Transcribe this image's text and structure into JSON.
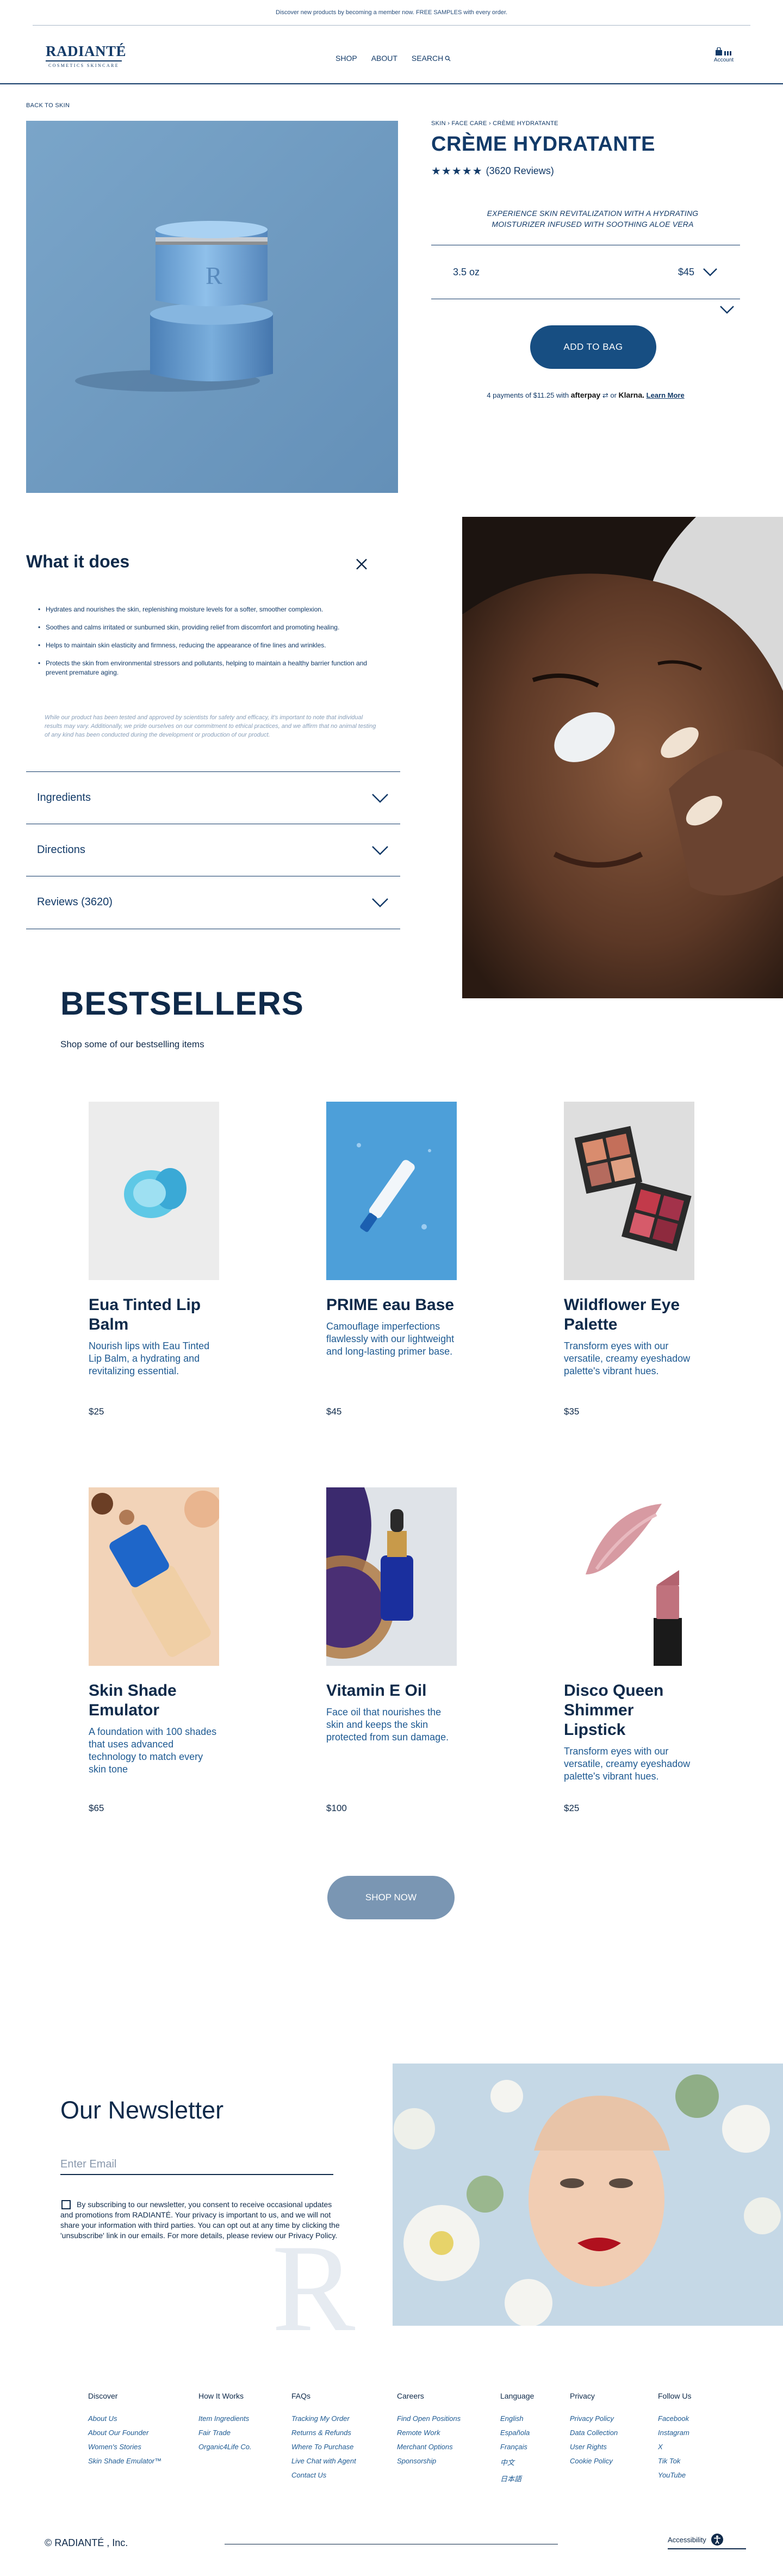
{
  "announcement": "Discover new products by becoming a member now. FREE SAMPLES with every order.",
  "logo": {
    "word": "RADIANTÉ",
    "tagline": "COSMETICS SKINCARE"
  },
  "nav": {
    "shop": "SHOP",
    "about": "ABOUT",
    "search": "SEARCH"
  },
  "account_label": "Account",
  "back_link": "BACK TO SKIN",
  "product": {
    "breadcrumb": "SKIN › FACE CARE › CRÈME HYDRATANTE",
    "title": "CRÈME HYDRATANTE",
    "stars": "★★★★★",
    "reviews": "(3620 Reviews)",
    "tagline": "EXPERIENCE SKIN REVITALIZATION WITH A HYDRATING MOISTURIZER INFUSED WITH SOOTHING ALOE VERA",
    "size": "3.5 oz",
    "price": "$45",
    "add_to_bag": "ADD TO BAG",
    "payment_pre": "4 payments of $11.25 with",
    "afterpay": "afterpay",
    "or": "or",
    "klarna": "Klarna.",
    "learn_more": "Learn More",
    "rating_value": 5
  },
  "what_it_does": {
    "title": "What it does",
    "bullets": [
      "Hydrates and nourishes the skin, replenishing moisture levels for a softer, smoother complexion.",
      "Soothes and calms irritated or sunburned skin, providing relief from discomfort and promoting healing.",
      "Helps to maintain skin elasticity and firmness, reducing the appearance of fine lines and wrinkles.",
      "Protects the skin from environmental stressors and pollutants, helping to maintain a healthy barrier function and prevent premature aging."
    ],
    "note": "While our product has been tested and approved by scientists for safety and efficacy, it's important to note that individual results may vary. Additionally, we pride ourselves on our commitment to ethical practices, and we affirm that no animal testing of any kind has been conducted during the development or production of our product."
  },
  "accordions": {
    "ingredients": "Ingredients",
    "directions": "Directions",
    "reviews": "Reviews (3620)"
  },
  "bestsellers": {
    "title": "BESTSELLERS",
    "subtitle": "Shop some of our bestselling items",
    "items": [
      {
        "name": "Eua Tinted Lip Balm",
        "desc": "Nourish lips with Eau Tinted Lip Balm, a hydrating and revitalizing essential.",
        "price": "$25"
      },
      {
        "name": "PRIME eau Base",
        "desc": "Camouflage imperfections flawlessly with our lightweight and long-lasting primer base.",
        "price": "$45"
      },
      {
        "name": "Wildflower Eye Palette",
        "desc": "Transform eyes with our versatile, creamy eyeshadow palette's vibrant hues.",
        "price": "$35"
      },
      {
        "name": "Skin Shade Emulator",
        "desc": "A foundation with 100 shades that uses advanced technology to match every skin tone",
        "price": "$65"
      },
      {
        "name": "Vitamin E Oil",
        "desc": "Face oil that nourishes the skin and keeps the skin protected from sun damage.",
        "price": "$100"
      },
      {
        "name": "Disco Queen Shimmer Lipstick",
        "desc": "Transform eyes with our versatile, creamy eyeshadow palette's vibrant hues.",
        "price": "$25"
      }
    ],
    "shop_now": "SHOP NOW"
  },
  "newsletter": {
    "title": "Our Newsletter",
    "placeholder": "Enter Email",
    "consent": "By subscribing to our newsletter, you consent to receive occasional updates and promotions from RADIANTÉ. Your privacy is important to us, and we will not share your information with third parties. You can opt out at any time by clicking the 'unsubscribe' link in our emails. For more details, please review our Privacy Policy.",
    "watermark": "R"
  },
  "footer": {
    "columns": [
      {
        "heading": "Discover",
        "links": [
          "About Us",
          "About Our Founder",
          "Women's Stories",
          "Skin Shade Emulator™"
        ]
      },
      {
        "heading": "How It Works",
        "links": [
          "Item Ingredients",
          "Fair Trade",
          "Organic4Life Co."
        ]
      },
      {
        "heading": "FAQs",
        "links": [
          "Tracking My Order",
          "Returns & Refunds",
          "Where To Purchase",
          "Live Chat with Agent",
          "Contact Us"
        ]
      },
      {
        "heading": "Careers",
        "links": [
          "Find Open Positions",
          "Remote Work",
          "Merchant Options",
          "Sponsorship"
        ]
      },
      {
        "heading": "Language",
        "links": [
          "English",
          "Española",
          "Français",
          "中文",
          "日本語"
        ]
      },
      {
        "heading": "Privacy",
        "links": [
          "Privacy Policy",
          "Data Collection",
          "User Rights",
          "Cookie Policy"
        ]
      },
      {
        "heading": "Follow Us",
        "links": [
          "Facebook",
          "Instagram",
          "X",
          "Tik Tok",
          "YouTube"
        ]
      }
    ],
    "copyright": "© RADIANTÉ , Inc.",
    "accessibility": "Accessibility"
  },
  "colors": {
    "navy": "#123a68",
    "deep": "#0f2a4a",
    "button": "#174e82",
    "shop_now": "#7a96b3",
    "product_bg": "#6f9cc2"
  }
}
